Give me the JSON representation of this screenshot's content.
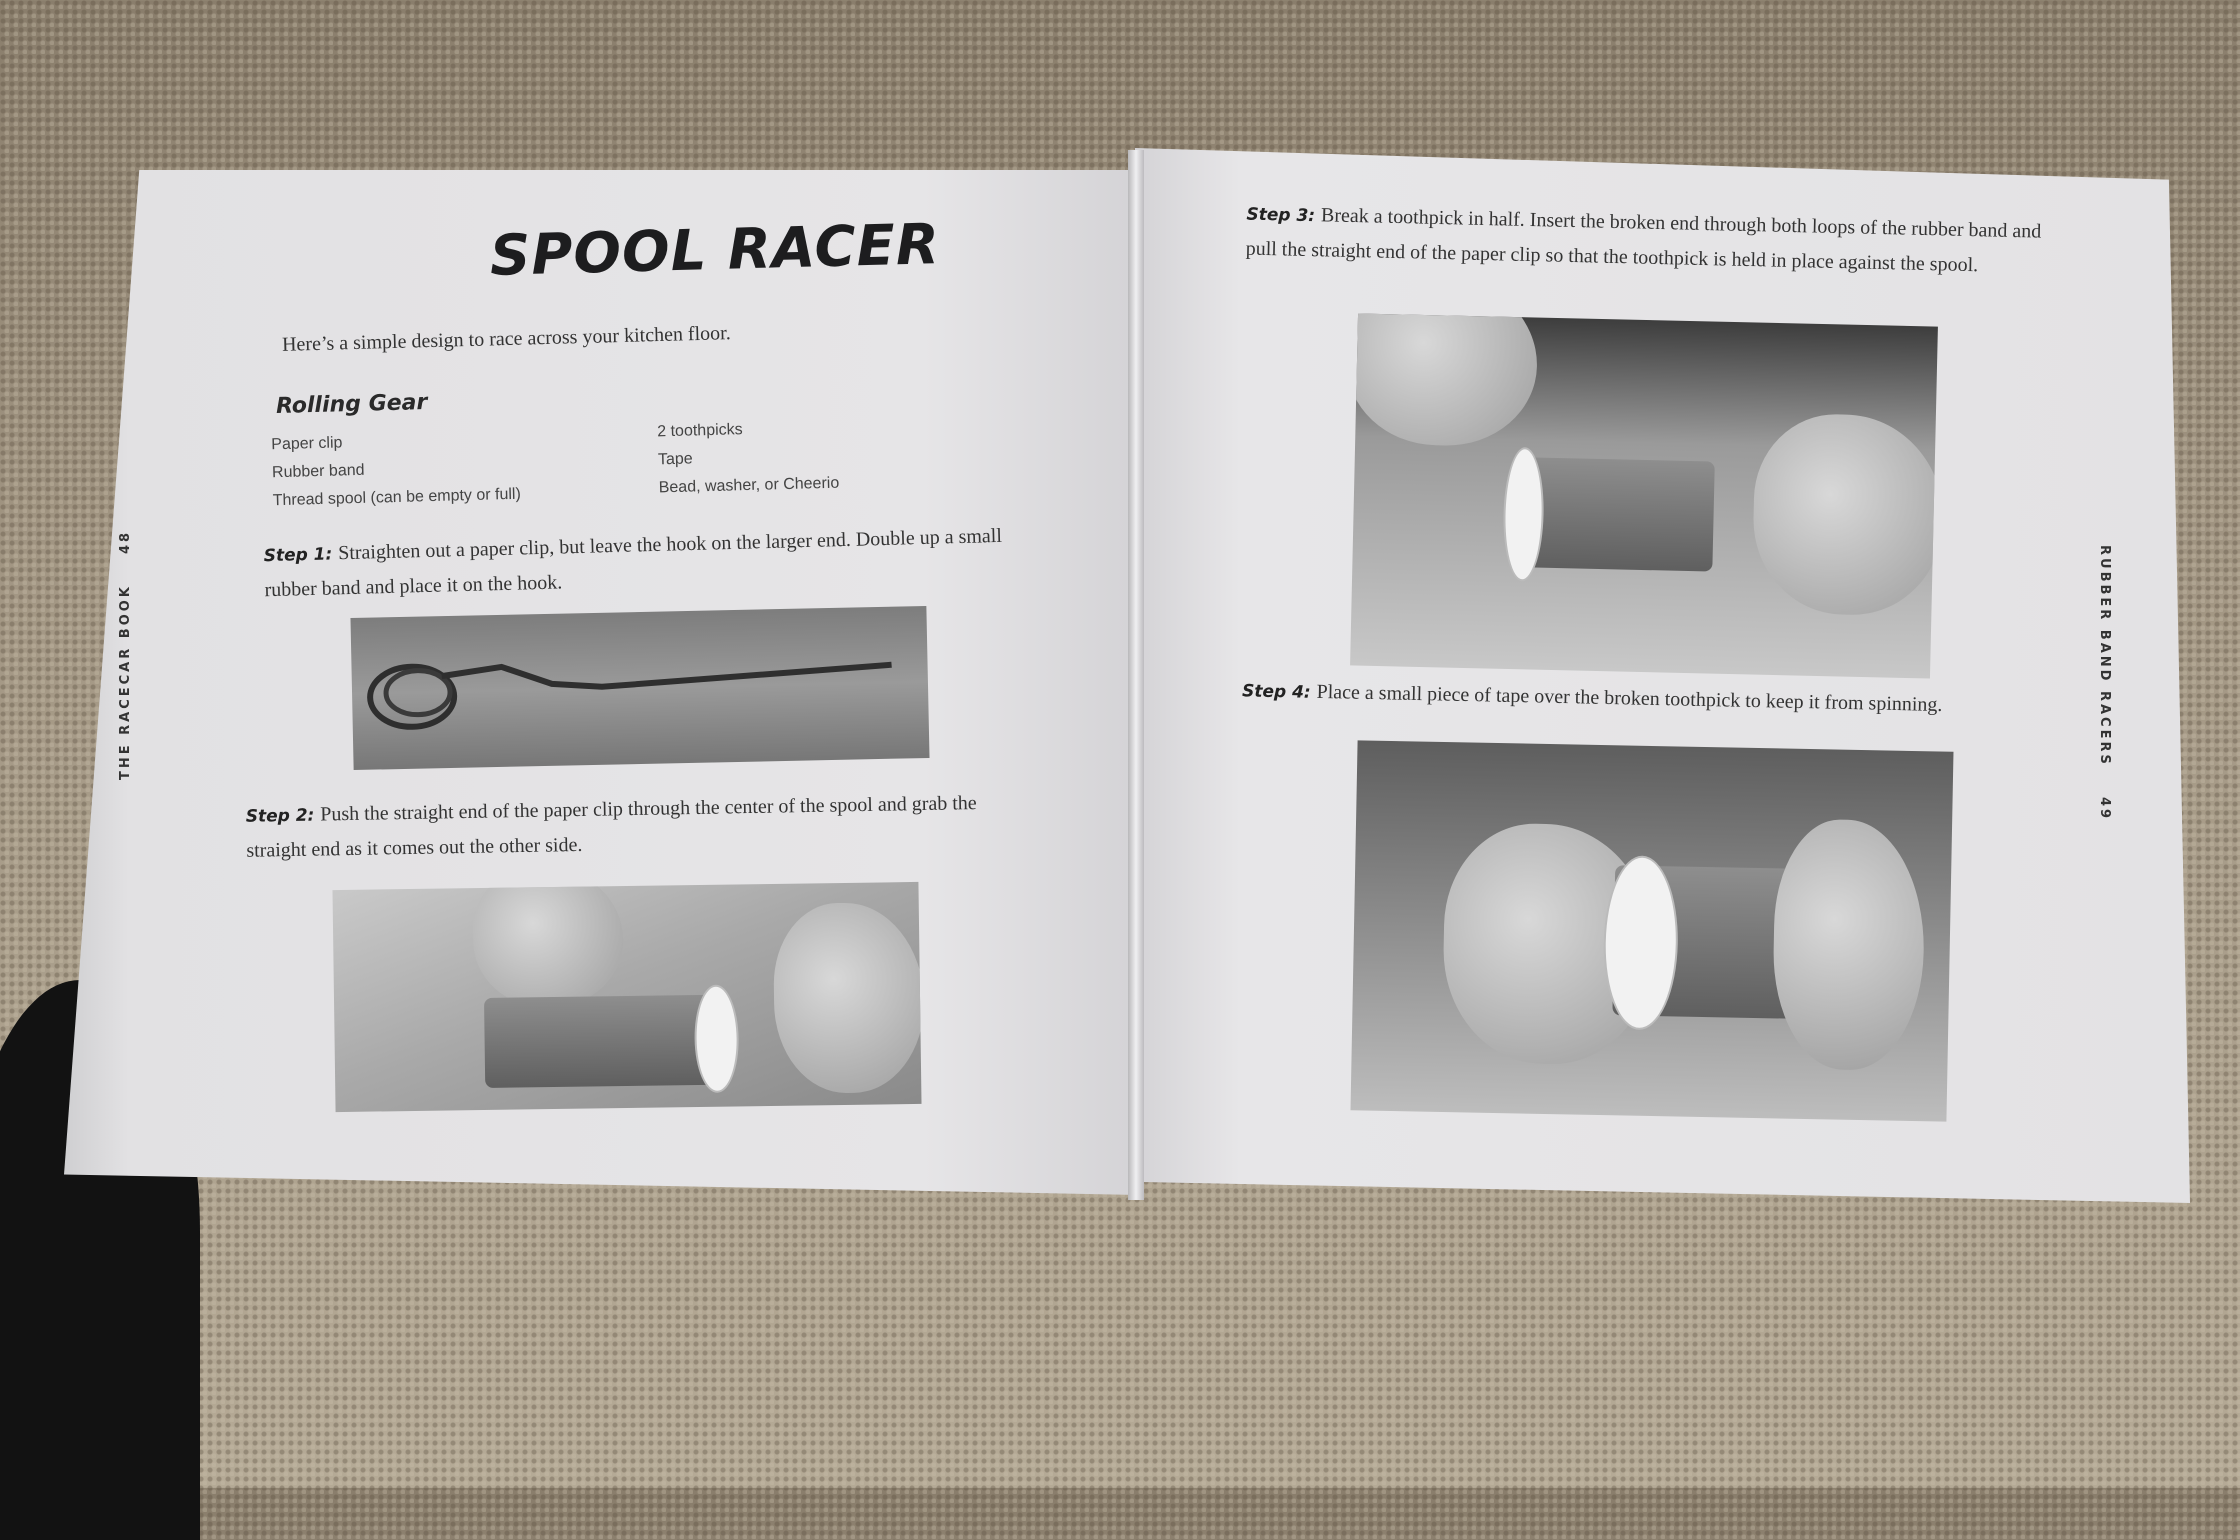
{
  "left_page": {
    "title": "SPOOL RACER",
    "intro": "Here’s a simple design to race across your kitchen floor.",
    "rolling_gear": {
      "heading": "Rolling Gear",
      "column_a": [
        "Paper clip",
        "Rubber band",
        "Thread spool (can be empty or full)"
      ],
      "column_b": [
        "2 toothpicks",
        "Tape",
        "Bead, washer, or Cheerio"
      ]
    },
    "step1": {
      "label": "Step 1:",
      "text": "Straighten out a paper clip, but leave the hook on the larger end. Double up a small rubber band and place it on the hook."
    },
    "step2": {
      "label": "Step 2:",
      "text": "Push the straight end of the paper clip through the center of the spool and grab the straight end as it comes out the other side."
    },
    "running_head": "THE RACECAR BOOK",
    "page_number": "48"
  },
  "right_page": {
    "step3": {
      "label": "Step 3:",
      "text": "Break a toothpick in half. Insert the broken end through both loops of the rubber band and pull the straight end of the paper clip so that the toothpick is held in place against the spool."
    },
    "step4": {
      "label": "Step 4:",
      "text": "Place a small piece of tape over the broken toothpick to keep it from spinning."
    },
    "running_head": "RUBBER BAND RACERS",
    "page_number": "49"
  }
}
